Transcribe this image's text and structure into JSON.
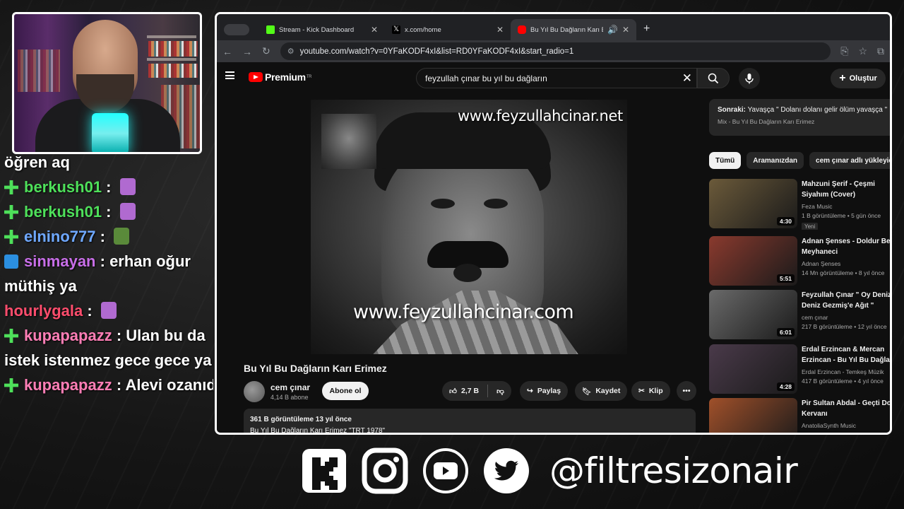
{
  "browser": {
    "tabs": [
      {
        "title": "Stream - Kick Dashboard",
        "favicon_color": "#53fc18"
      },
      {
        "title": "x.com/home",
        "favicon_color": "#ffffff"
      },
      {
        "title": "Bu Yıl Bu Dağların Karı Erimez",
        "favicon_color": "#ff0000"
      }
    ],
    "url": "youtube.com/watch?v=0YFaKODF4xI&list=RD0YFaKODF4xI&start_radio=1"
  },
  "youtube": {
    "logo_text": "Premium",
    "logo_sup": "TR",
    "search_value": "feyzullah çınar bu yıl bu dağların",
    "create_label": "Oluştur",
    "video": {
      "watermark_top": "www.feyzullahcinar.net",
      "watermark_bottom": "www.feyzullahcinar.com",
      "title": "Bu Yıl Bu Dağların Karı Erimez",
      "channel": "cem çınar",
      "subscribers": "4,14 B abone",
      "subscribe_label": "Abone ol",
      "likes": "2,7 B",
      "share_label": "Paylaş",
      "save_label": "Kaydet",
      "clip_label": "Klip",
      "desc_stats": "361 B görüntüleme  13 yıl önce",
      "desc_text": "Bu Yıl Bu Dağların Karı Erimez \"TRT 1978\""
    },
    "up_next": {
      "label": "Sonraki:",
      "title": "Yavaşça \" Dolanı dolanı gelir ölüm yavaşça \"",
      "mix": "Mix - Bu Yıl Bu Dağların Karı Erimez"
    },
    "chips": [
      "Tümü",
      "Aramanızdan",
      "cem çınar adlı yükleyiciden"
    ],
    "recommendations": [
      {
        "title": "Mahzuni Şerif - Çeşmi Siyahım (Cover)",
        "channel": "Feza Music",
        "views": "1 B görüntüleme • 5 gün önce",
        "duration": "4:30",
        "badge": "Yeni",
        "thumb": "#6b5a3a"
      },
      {
        "title": "Adnan Şenses - Doldur Be Meyhaneci",
        "channel": "Adnan Şenses",
        "views": "14 Mn görüntüleme • 8 yıl önce",
        "duration": "5:51",
        "badge": "",
        "thumb": "#8a3a2e"
      },
      {
        "title": "Feyzullah Çınar  \" Oy Deniz Deniz Gezmiş'e Ağıt \"",
        "channel": "cem çınar",
        "views": "217 B görüntüleme • 12 yıl önce",
        "duration": "6:01",
        "badge": "",
        "thumb": "#6a6a6a"
      },
      {
        "title": "Erdal Erzincan & Mercan Erzincan - Bu Yıl Bu Dağların",
        "channel": "Erdal Erzincan - Temkeş Müzik",
        "views": "417 B görüntüleme • 4 yıl önce",
        "duration": "4:28",
        "badge": "",
        "thumb": "#4a3a4a"
      },
      {
        "title": "Pir Sultan Abdal  - Geçti Dost Kervanı",
        "channel": "AnatoliaSynth Music",
        "views": "",
        "duration": "",
        "badge": "",
        "thumb": "#a0502a"
      }
    ]
  },
  "chat": [
    {
      "user": "",
      "color": "#ffffff",
      "text": "öğren aq",
      "badge": "",
      "emote": false
    },
    {
      "user": "berkush01",
      "color": "#4ee05a",
      "text": "",
      "badge": "g",
      "emote": true
    },
    {
      "user": "berkush01",
      "color": "#4ee05a",
      "text": "",
      "badge": "g",
      "emote": true
    },
    {
      "user": "elnino777",
      "color": "#6fa8ff",
      "text": "",
      "badge": "g",
      "emote": true
    },
    {
      "user": "sinmayan",
      "color": "#c86ee8",
      "text": "erhan oğur müthiş ya",
      "badge": "b",
      "emote": false
    },
    {
      "user": "hourlygala",
      "color": "#ff4d6d",
      "text": "",
      "badge": "",
      "emote": true
    },
    {
      "user": "kupapapazz",
      "color": "#ff7eb6",
      "text": "Ulan bu da istek istenmez gece gece ya",
      "badge": "g",
      "emote": false
    },
    {
      "user": "kupapapazz",
      "color": "#ff7eb6",
      "text": "Alevi ozanıdır",
      "badge": "g",
      "emote": false
    }
  ],
  "social_handle": "@filtresizonair"
}
